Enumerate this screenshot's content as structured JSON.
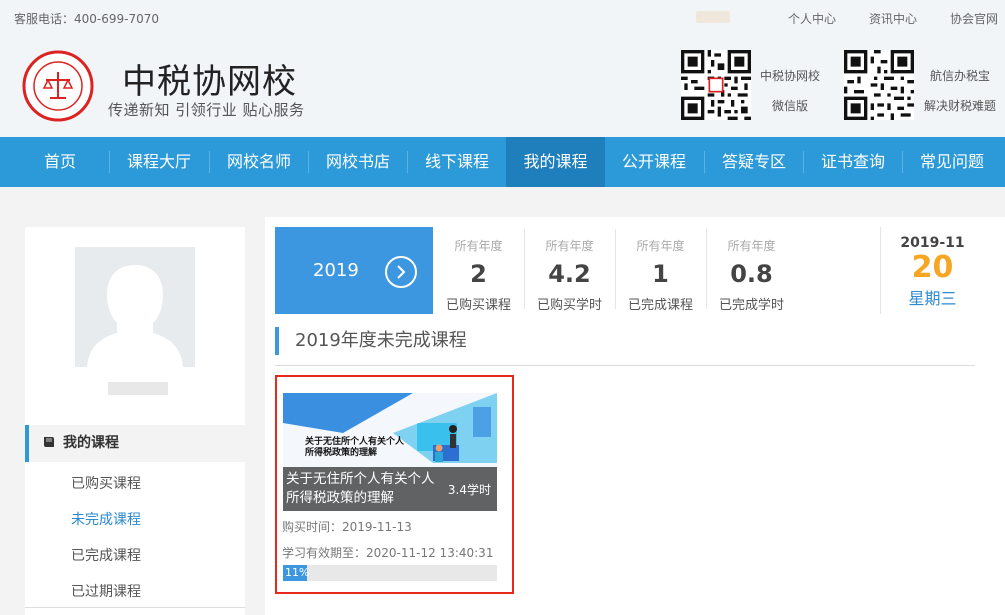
{
  "topbar": {
    "phone": "客服电话：400-699-7070",
    "links": [
      "个人中心",
      "资讯中心",
      "协会官网"
    ]
  },
  "header": {
    "site_name": "中税协网校",
    "slogan": "传递新知 引领行业 贴心服务",
    "qr_left_label_1": "中税协网校",
    "qr_left_label_2": "微信版",
    "qr_right_label_1": "航信办税宝",
    "qr_right_label_2": "解决财税难题"
  },
  "nav": {
    "items": [
      "首页",
      "课程大厅",
      "网校名师",
      "网校书店",
      "线下课程",
      "我的课程",
      "公开课程",
      "答疑专区",
      "证书查询",
      "常见问题"
    ],
    "active_index": 5
  },
  "sidebar": {
    "menu_title": "我的课程",
    "items": [
      "已购买课程",
      "未完成课程",
      "已完成课程",
      "已过期课程"
    ],
    "current_item": "未完成课程"
  },
  "stats": {
    "year": "2019",
    "items": [
      {
        "label": "所有年度",
        "value": "2",
        "desc": "已购买课程"
      },
      {
        "label": "所有年度",
        "value": "4.2",
        "desc": "已购买学时"
      },
      {
        "label": "所有年度",
        "value": "1",
        "desc": "已完成课程"
      },
      {
        "label": "所有年度",
        "value": "0.8",
        "desc": "已完成学时"
      }
    ]
  },
  "date": {
    "year_month": "2019-11",
    "day": "20",
    "weekday": "星期三"
  },
  "section": {
    "title": "2019年度未完成课程"
  },
  "course": {
    "thumb_text_1": "关于无住所个人有关个人",
    "thumb_text_2": "所得税政策的理解",
    "title": "关于无住所个人有关个人所得税政策的理解",
    "hours": "3.4学时",
    "purchase_time": "购买时间：2019-11-13",
    "valid_until": "学习有效期至：2020-11-12 13:40:31",
    "progress_text": "11%",
    "progress": 0.11
  },
  "colors": {
    "nav": "#2c9ad9",
    "nav_active": "#1e7fbc",
    "accent": "#3d97e0",
    "date_day": "#f6a623",
    "card_border": "#e8281d"
  }
}
